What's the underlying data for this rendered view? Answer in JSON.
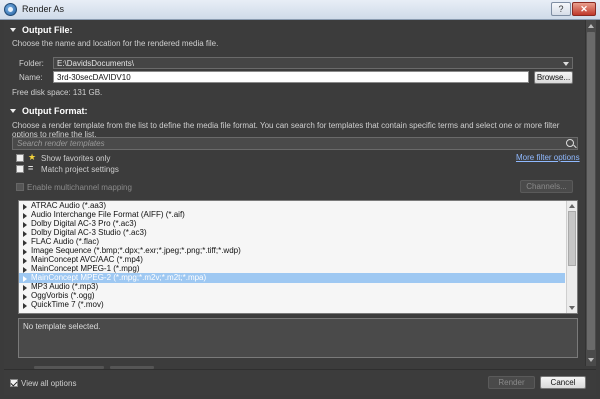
{
  "window": {
    "title": "Render As",
    "help_label": "?",
    "close_label": "✕"
  },
  "output_file": {
    "heading": "Output File:",
    "description": "Choose the name and location for the rendered media file.",
    "folder_label": "Folder:",
    "folder_value": "E:\\DavidsDocuments\\",
    "name_label": "Name:",
    "name_value": "3rd-30secDAVIDV10",
    "browse_label": "Browse...",
    "free_space": "Free disk space: 131 GB."
  },
  "output_format": {
    "heading": "Output Format:",
    "description": "Choose a render template from the list to define the media file format. You can search for templates that contain specific terms and select one or more filter options to refine the list.",
    "search_placeholder": "Search render templates",
    "show_favorites_label": "Show favorites only",
    "match_project_label": "Match project settings",
    "more_filter_label": "More filter options",
    "multichannel_label": "Enable multichannel mapping",
    "channels_label": "Channels...",
    "formats": [
      "ATRAC Audio (*.aa3)",
      "Audio Interchange File Format (AIFF) (*.aif)",
      "Dolby Digital AC-3 Pro (*.ac3)",
      "Dolby Digital AC-3 Studio (*.ac3)",
      "FLAC Audio (*.flac)",
      "Image Sequence (*.bmp;*.dpx;*.exr;*.jpeg;*.png;*.tiff;*.wdp)",
      "MainConcept AVC/AAC (*.mp4)",
      "MainConcept MPEG-1 (*.mpg)",
      "MainConcept MPEG-2 (*.mpg;*.m2v;*.m2t;*.mpa)",
      "MP3 Audio (*.mp3)",
      "OggVorbis (*.ogg)",
      "QuickTime 7 (*.mov)"
    ],
    "selected_index": 8,
    "info_text": "No template selected."
  },
  "footer": {
    "view_all_label": "View all options",
    "view_all_checked": true,
    "render_label": "Render",
    "cancel_label": "Cancel"
  }
}
